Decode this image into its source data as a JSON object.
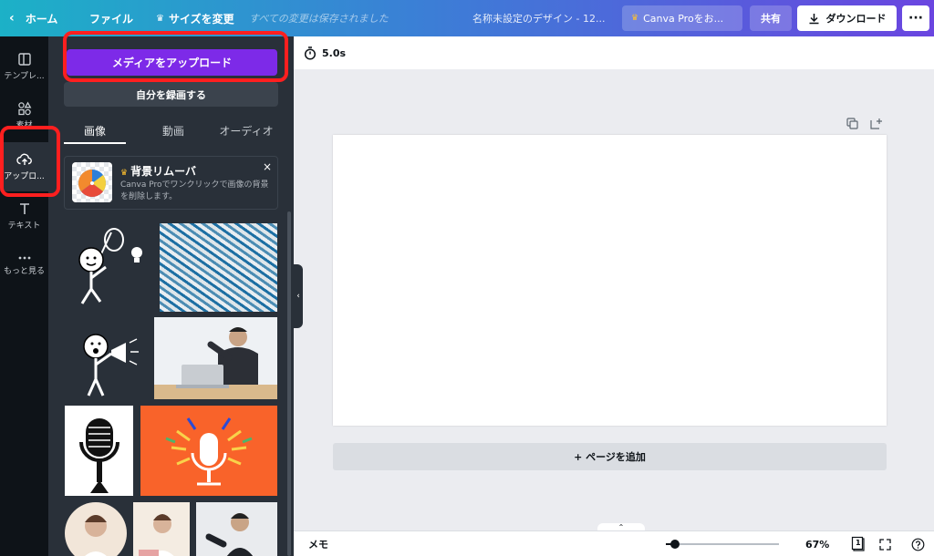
{
  "topbar": {
    "home": "ホーム",
    "file": "ファイル",
    "resize": "サイズを変更",
    "saved": "すべての変更は保存されました",
    "title": "名称未設定のデザイン - 12...",
    "canva_pro": "Canva Proをお...",
    "share": "共有",
    "download": "ダウンロード",
    "more": "···"
  },
  "rail": {
    "items": [
      {
        "label": "テンプレ...",
        "icon": "template-icon"
      },
      {
        "label": "素材",
        "icon": "elements-icon"
      },
      {
        "label": "アップロ...",
        "icon": "upload-cloud-icon"
      },
      {
        "label": "テキスト",
        "icon": "text-icon"
      },
      {
        "label": "もっと見る",
        "icon": "more-icon"
      }
    ]
  },
  "panel": {
    "upload_media": "メディアをアップロード",
    "record_self": "自分を録画する",
    "tabs": [
      "画像",
      "動画",
      "オーディオ"
    ],
    "promo": {
      "title": "背景リムーバ",
      "desc": "Canva Proでワンクリックで画像の背景を削除します。",
      "close": "×"
    }
  },
  "canvas": {
    "duration": "5.0s",
    "add_page": "+ ページを追加"
  },
  "bottombar": {
    "memo": "メモ",
    "zoom": "67%",
    "page_count": "1"
  },
  "colors": {
    "accent_purple": "#7d2ae8",
    "highlight_red": "#ff1f1f",
    "rail_bg": "#0e1318",
    "panel_bg": "#293039"
  }
}
